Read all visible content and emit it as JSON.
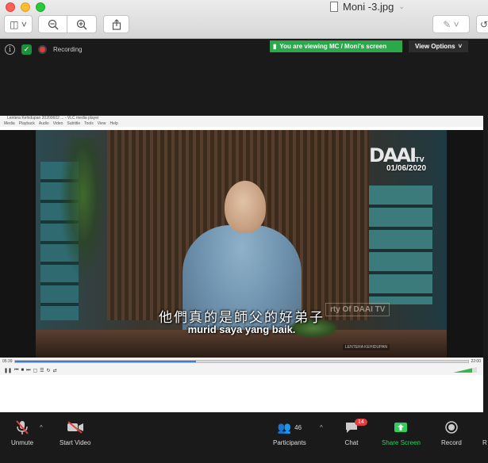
{
  "preview_window": {
    "document_title": "Moni -3.jpg",
    "toolbar": {
      "sidebar_icon": "sidebar-icon",
      "zoom_out_icon": "zoom-out-icon",
      "zoom_in_icon": "zoom-in-icon",
      "share_icon": "share-icon",
      "markup_icon": "markup-icon"
    }
  },
  "zoom": {
    "recording_label": "Recording",
    "viewing_banner": "You are viewing MC / Moni's screen",
    "view_options_label": "View Options",
    "toolbar": {
      "unmute_label": "Unmute",
      "start_video_label": "Start Video",
      "participants_label": "Participants",
      "participants_count": "46",
      "chat_label": "Chat",
      "chat_badge": "14",
      "share_screen_label": "Share Screen",
      "record_label": "Record",
      "reactions_label": "R"
    }
  },
  "vlc": {
    "window_title": "Lentera Kehidupan 20200602 ... - VLC media player",
    "menu": [
      "Media",
      "Playback",
      "Audio",
      "Video",
      "Subtitle",
      "Tools",
      "View",
      "Help"
    ],
    "time_elapsed": "05:39",
    "time_total": "22:00",
    "progress_fraction": 0.4,
    "volume_fraction": 0.8
  },
  "video": {
    "logo": "DAAI",
    "logo_tv": "TV",
    "date": "01/06/2020",
    "subtitle_chinese": "他們真的是師父的好弟子",
    "subtitle_indonesian": "murid saya yang baik.",
    "watermark": "rty Of DAAI TV",
    "program_tag": "LENTERA KEHIDUPAN"
  }
}
